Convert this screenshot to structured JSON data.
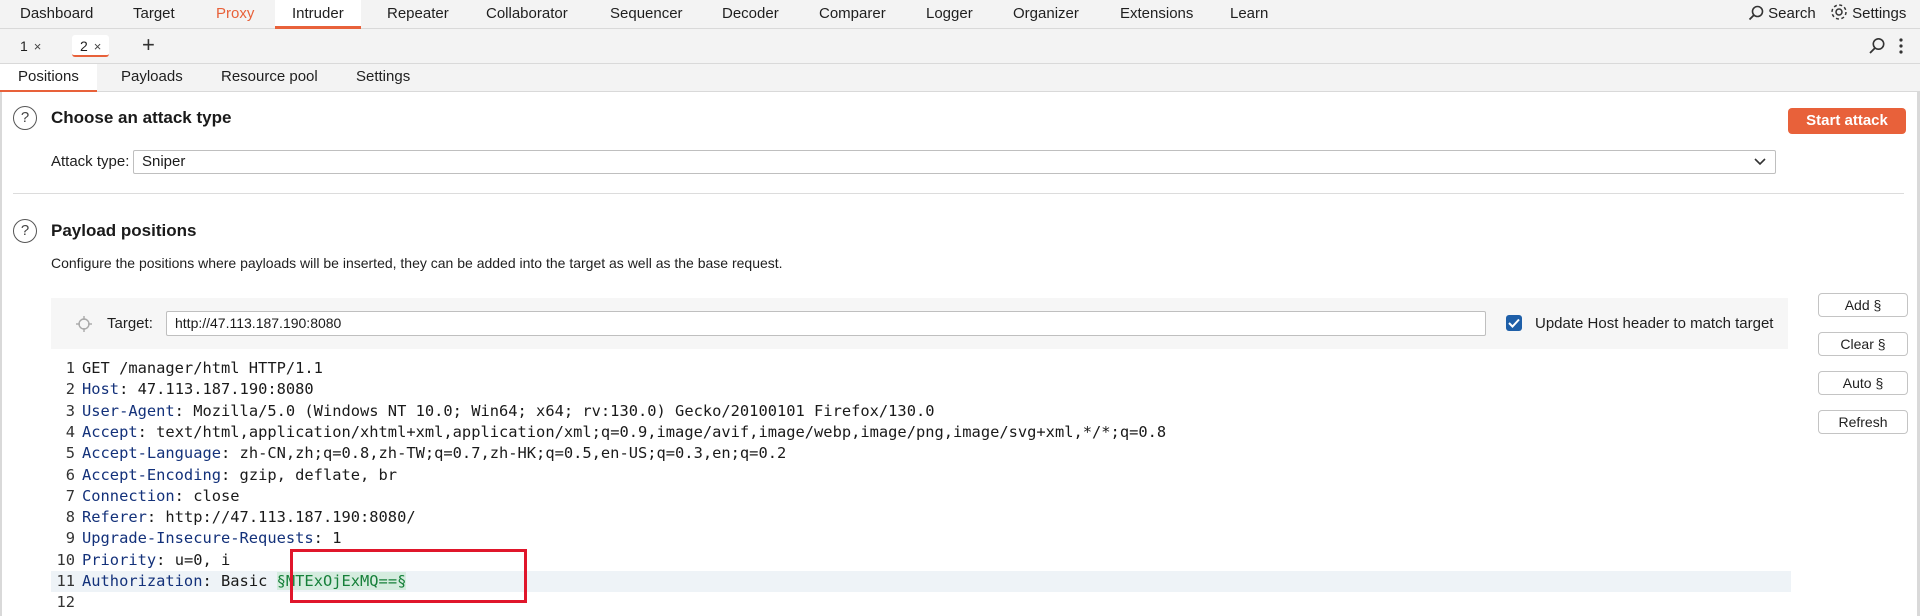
{
  "topnav": {
    "tabs": [
      "Dashboard",
      "Target",
      "Proxy",
      "Intruder",
      "Repeater",
      "Collaborator",
      "Sequencer",
      "Decoder",
      "Comparer",
      "Logger",
      "Organizer",
      "Extensions",
      "Learn"
    ],
    "search_label": "Search",
    "settings_label": "Settings"
  },
  "subtabs": [
    {
      "label": "1",
      "close": "×"
    },
    {
      "label": "2",
      "close": "×"
    }
  ],
  "add_tab": "+",
  "sectabs": [
    "Positions",
    "Payloads",
    "Resource pool",
    "Settings"
  ],
  "attack": {
    "title": "Choose an attack type",
    "start_label": "Start attack",
    "type_label": "Attack type:",
    "type_value": "Sniper"
  },
  "positions": {
    "title": "Payload positions",
    "description": "Configure the positions where payloads will be inserted, they can be added into the target as well as the base request.",
    "target_label": "Target:",
    "target_value": "http://47.113.187.190:8080",
    "update_host_label": "Update Host header to match target",
    "update_host_checked": true,
    "buttons": {
      "add": "Add §",
      "clear": "Clear §",
      "auto": "Auto §",
      "refresh": "Refresh"
    }
  },
  "request": {
    "lines": [
      {
        "n": "1",
        "key": "",
        "sep": "",
        "val": "GET /manager/html HTTP/1.1"
      },
      {
        "n": "2",
        "key": "Host",
        "sep": ": ",
        "val": "47.113.187.190:8080"
      },
      {
        "n": "3",
        "key": "User-Agent",
        "sep": ": ",
        "val": "Mozilla/5.0 (Windows NT 10.0; Win64; x64; rv:130.0) Gecko/20100101 Firefox/130.0"
      },
      {
        "n": "4",
        "key": "Accept",
        "sep": ": ",
        "val": "text/html,application/xhtml+xml,application/xml;q=0.9,image/avif,image/webp,image/png,image/svg+xml,*/*;q=0.8"
      },
      {
        "n": "5",
        "key": "Accept-Language",
        "sep": ": ",
        "val": "zh-CN,zh;q=0.8,zh-TW;q=0.7,zh-HK;q=0.5,en-US;q=0.3,en;q=0.2"
      },
      {
        "n": "6",
        "key": "Accept-Encoding",
        "sep": ": ",
        "val": "gzip, deflate, br"
      },
      {
        "n": "7",
        "key": "Connection",
        "sep": ": ",
        "val": "close"
      },
      {
        "n": "8",
        "key": "Referer",
        "sep": ": ",
        "val": "http://47.113.187.190:8080/"
      },
      {
        "n": "9",
        "key": "Upgrade-Insecure-Requests",
        "sep": ": ",
        "val": "1"
      },
      {
        "n": "10",
        "key": "Priority",
        "sep": ": ",
        "val": "u=0, i"
      },
      {
        "n": "11",
        "key": "Authorization",
        "sep": ": ",
        "val": "Basic ",
        "marker": "§MTExOjExMQ==§"
      },
      {
        "n": "12",
        "key": "",
        "sep": "",
        "val": ""
      }
    ]
  },
  "colors": {
    "accent": "#e8613a",
    "header_key": "#13317a",
    "marker": "#16803a",
    "highlight_box": "#e0162b"
  }
}
